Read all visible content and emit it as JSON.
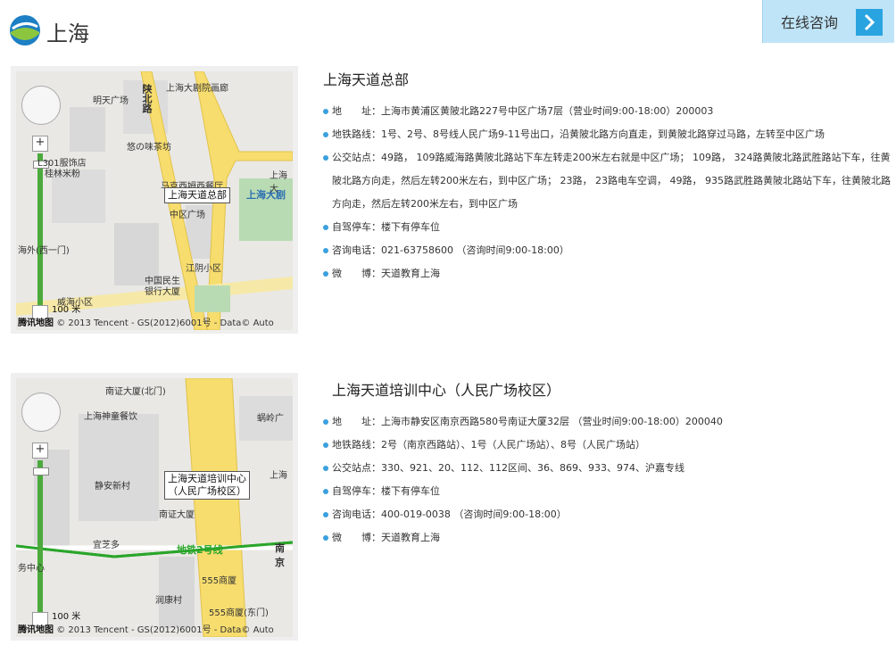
{
  "header": {
    "city": "上海",
    "consult_label": "在线咨询"
  },
  "locations": [
    {
      "title": "上海天道总部",
      "map_marker": "上海天道总部",
      "map_labels": [
        "明天广场",
        "陕北路",
        "上海大剧院画廊",
        "悠の味茶坊",
        "L301服饰店",
        "桂林米粉",
        "马克西姆西餐厅",
        "上海大剧",
        "中区广场",
        "上海大",
        "江阴小区",
        "中国民生银行大厦",
        "威海小区",
        "海外(西一门)"
      ],
      "scale": "100 米",
      "copyright_brand": "腾讯地图",
      "copyright": "© 2013 Tencent - GS(2012)6001号 - Data© Auto",
      "details": [
        "地　　址：上海市黄浦区黄陂北路227号中区广场7层（营业时间9:00-18:00）200003",
        "地铁路线：1号、2号、8号线人民广场9-11号出口，沿黄陂北路方向直走，到黄陂北路穿过马路，左转至中区广场",
        "公交站点：49路， 109路威海路黄陂北路站下车左转走200米左右就是中区广场； 109路， 324路黄陂北路武胜路站下车，往黄陂北路方向走，然后左转200米左右，到中区广场； 23路， 23路电车空调， 49路， 935路武胜路黄陂北路站下车，往黄陂北路方向走，然后左转200米左右，到中区广场",
        "自驾停车：楼下有停车位",
        "咨询电话：021-63758600 （咨询时间9:00-18:00）",
        "微　　博：天道教育上海"
      ]
    },
    {
      "title": "上海天道培训中心（人民广场校区）",
      "map_marker_line1": "上海天道培训中心",
      "map_marker_line2": "（人民广场校区）",
      "map_labels": [
        "南证大厦(北门)",
        "上海神童餐饮",
        "静安新村",
        "南证大厦",
        "宜芝多",
        "地铁2号线",
        "南京",
        "555商厦",
        "润康村",
        "555商厦(东门)",
        "蜗岭广",
        "上海",
        "务中心"
      ],
      "scale": "100 米",
      "copyright_brand": "腾讯地图",
      "copyright": "© 2013 Tencent - GS(2012)6001号 - Data© Auto",
      "details": [
        "地　　址：上海市静安区南京西路580号南证大厦32层 （营业时间9:00-18:00）200040",
        "地铁路线：2号（南京西路站）、1号（人民广场站）、8号（人民广场站）",
        "公交站点：330、921、20、112、112区间、36、869、933、974、沪嘉专线",
        "自驾停车：楼下有停车位",
        "咨询电话：400-019-0038 （咨询时间9:00-18:00）",
        "微　　博：天道教育上海"
      ]
    }
  ],
  "colors": {
    "accent": "#2aa4e0",
    "consult_bg": "#bfe4f7",
    "road_yellow": "#f7dd6e",
    "metro_green": "#2aa52a"
  }
}
